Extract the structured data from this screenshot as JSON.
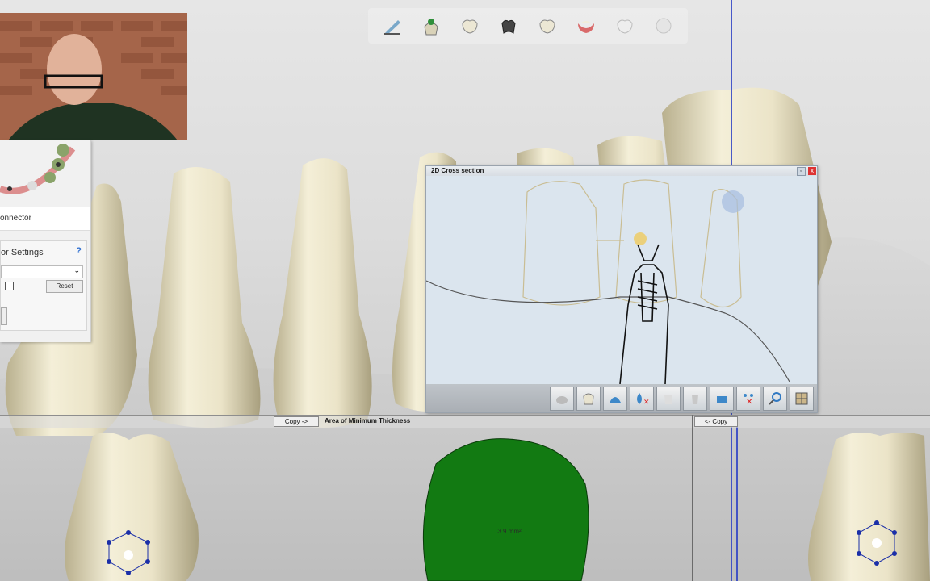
{
  "toolbar": {
    "icons": [
      "pen-icon",
      "tooth-crown-icon",
      "tooth-icon",
      "dark-tooth-icon",
      "tooth-icon",
      "gum-icon",
      "tooth-faded-icon",
      "sphere-icon"
    ]
  },
  "left_panel": {
    "connector_label": "onnector",
    "settings_title": "or Settings",
    "help_mark": "?",
    "reset_label": "Reset"
  },
  "cross_section": {
    "title": "2D Cross section",
    "close_label": "x",
    "pin_label": "▫"
  },
  "bottom": {
    "copy_right_label": "Copy ->",
    "area_title": "Area of Minimum Thickness",
    "copy_left_label": "<- Copy",
    "thickness_value": "3.9 mm²"
  },
  "colors": {
    "tooth": "#e9e2c6",
    "gingiva": "#cfcfcf",
    "area_fill": "#127a12",
    "accent_blue": "#2b3fc4"
  }
}
